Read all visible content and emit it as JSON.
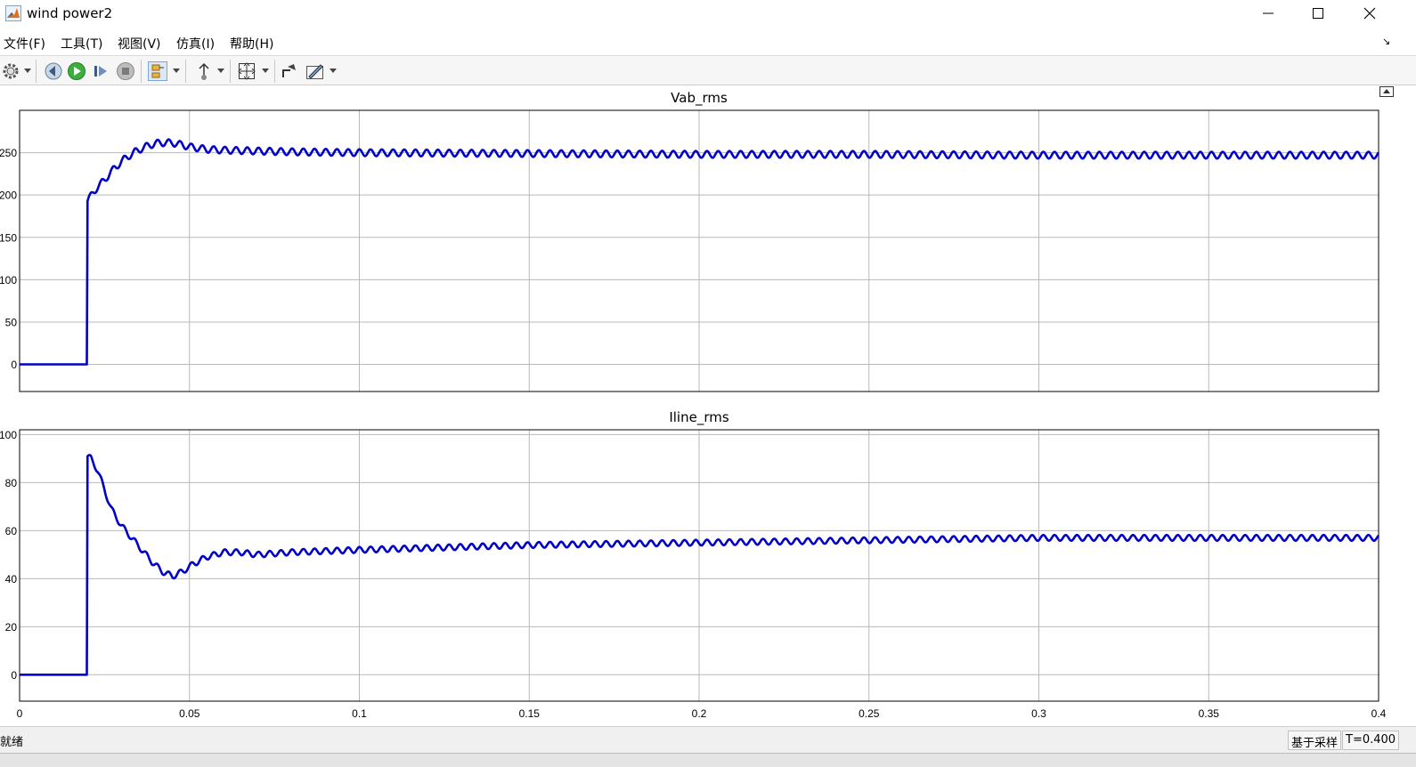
{
  "window": {
    "title": "wind power2"
  },
  "menu": {
    "items": [
      "文件(F)",
      "工具(T)",
      "视图(V)",
      "仿真(I)",
      "帮助(H)"
    ]
  },
  "icons": {
    "app": "matlab-logo-icon",
    "toolbar": [
      "settings-icon",
      "step-back-icon",
      "run-icon",
      "step-forward-icon",
      "stop-icon",
      "highlight-block-icon",
      "signal-selector-icon",
      "zoom-fit-icon",
      "restore-layout-icon",
      "style-icon"
    ]
  },
  "colors": {
    "trace": "#0000c8",
    "grid": "#b9b9b9",
    "axes": "#000000"
  },
  "status": {
    "ready": "就绪",
    "mode": "基于采样",
    "time": "T=0.400"
  },
  "chart_data": [
    {
      "type": "line",
      "title": "Vab_rms",
      "xlabel": "",
      "ylabel": "",
      "xlim": [
        0,
        0.4
      ],
      "ylim": [
        -32,
        300
      ],
      "xticks": [
        0,
        0.05,
        0.1,
        0.15,
        0.2,
        0.25,
        0.3,
        0.35,
        0.4
      ],
      "yticks": [
        0,
        50,
        100,
        150,
        200,
        250
      ],
      "ytick_labels": [
        "0",
        "50",
        "100",
        "150",
        "200",
        "250"
      ],
      "grid": true,
      "series": [
        {
          "x": [
            0,
            0.0198,
            0.02,
            0.022,
            0.025,
            0.028,
            0.031,
            0.034,
            0.037,
            0.04,
            0.043,
            0.046,
            0.05,
            0.055,
            0.06,
            0.07,
            0.08,
            0.1,
            0.15,
            0.2,
            0.25,
            0.3,
            0.35,
            0.4
          ],
          "y": [
            0,
            0,
            193,
            205,
            218,
            232,
            243,
            251,
            257,
            261,
            262,
            261,
            257,
            254,
            253,
            252,
            251,
            250,
            249,
            248,
            248,
            247,
            247,
            247
          ],
          "ripple_amplitude": 4,
          "ripple_period": 0.0033
        }
      ]
    },
    {
      "type": "line",
      "title": "Iline_rms",
      "xlabel": "",
      "ylabel": "",
      "xlim": [
        0,
        0.4
      ],
      "ylim": [
        -11,
        102
      ],
      "xticks": [
        0,
        0.05,
        0.1,
        0.15,
        0.2,
        0.25,
        0.3,
        0.35,
        0.4
      ],
      "xtick_labels": [
        "0",
        "0.05",
        "0.1",
        "0.15",
        "0.2",
        "0.25",
        "0.3",
        "0.35",
        "0.4"
      ],
      "yticks": [
        0,
        20,
        40,
        60,
        80,
        100
      ],
      "ytick_labels": [
        "0",
        "20",
        "40",
        "60",
        "80",
        "100"
      ],
      "grid": true,
      "series": [
        {
          "x": [
            0,
            0.0198,
            0.02,
            0.021,
            0.023,
            0.025,
            0.027,
            0.03,
            0.033,
            0.036,
            0.039,
            0.042,
            0.045,
            0.048,
            0.051,
            0.055,
            0.06,
            0.065,
            0.07,
            0.08,
            0.1,
            0.15,
            0.2,
            0.25,
            0.3,
            0.35,
            0.4
          ],
          "y": [
            0,
            0,
            91,
            90,
            85,
            77,
            69,
            62,
            57,
            52,
            47,
            43,
            41,
            43,
            46,
            49,
            51,
            51,
            50,
            51,
            52,
            54,
            55,
            56,
            57,
            57,
            57
          ],
          "ripple_amplitude": 1.2,
          "ripple_period": 0.0033
        }
      ]
    }
  ]
}
